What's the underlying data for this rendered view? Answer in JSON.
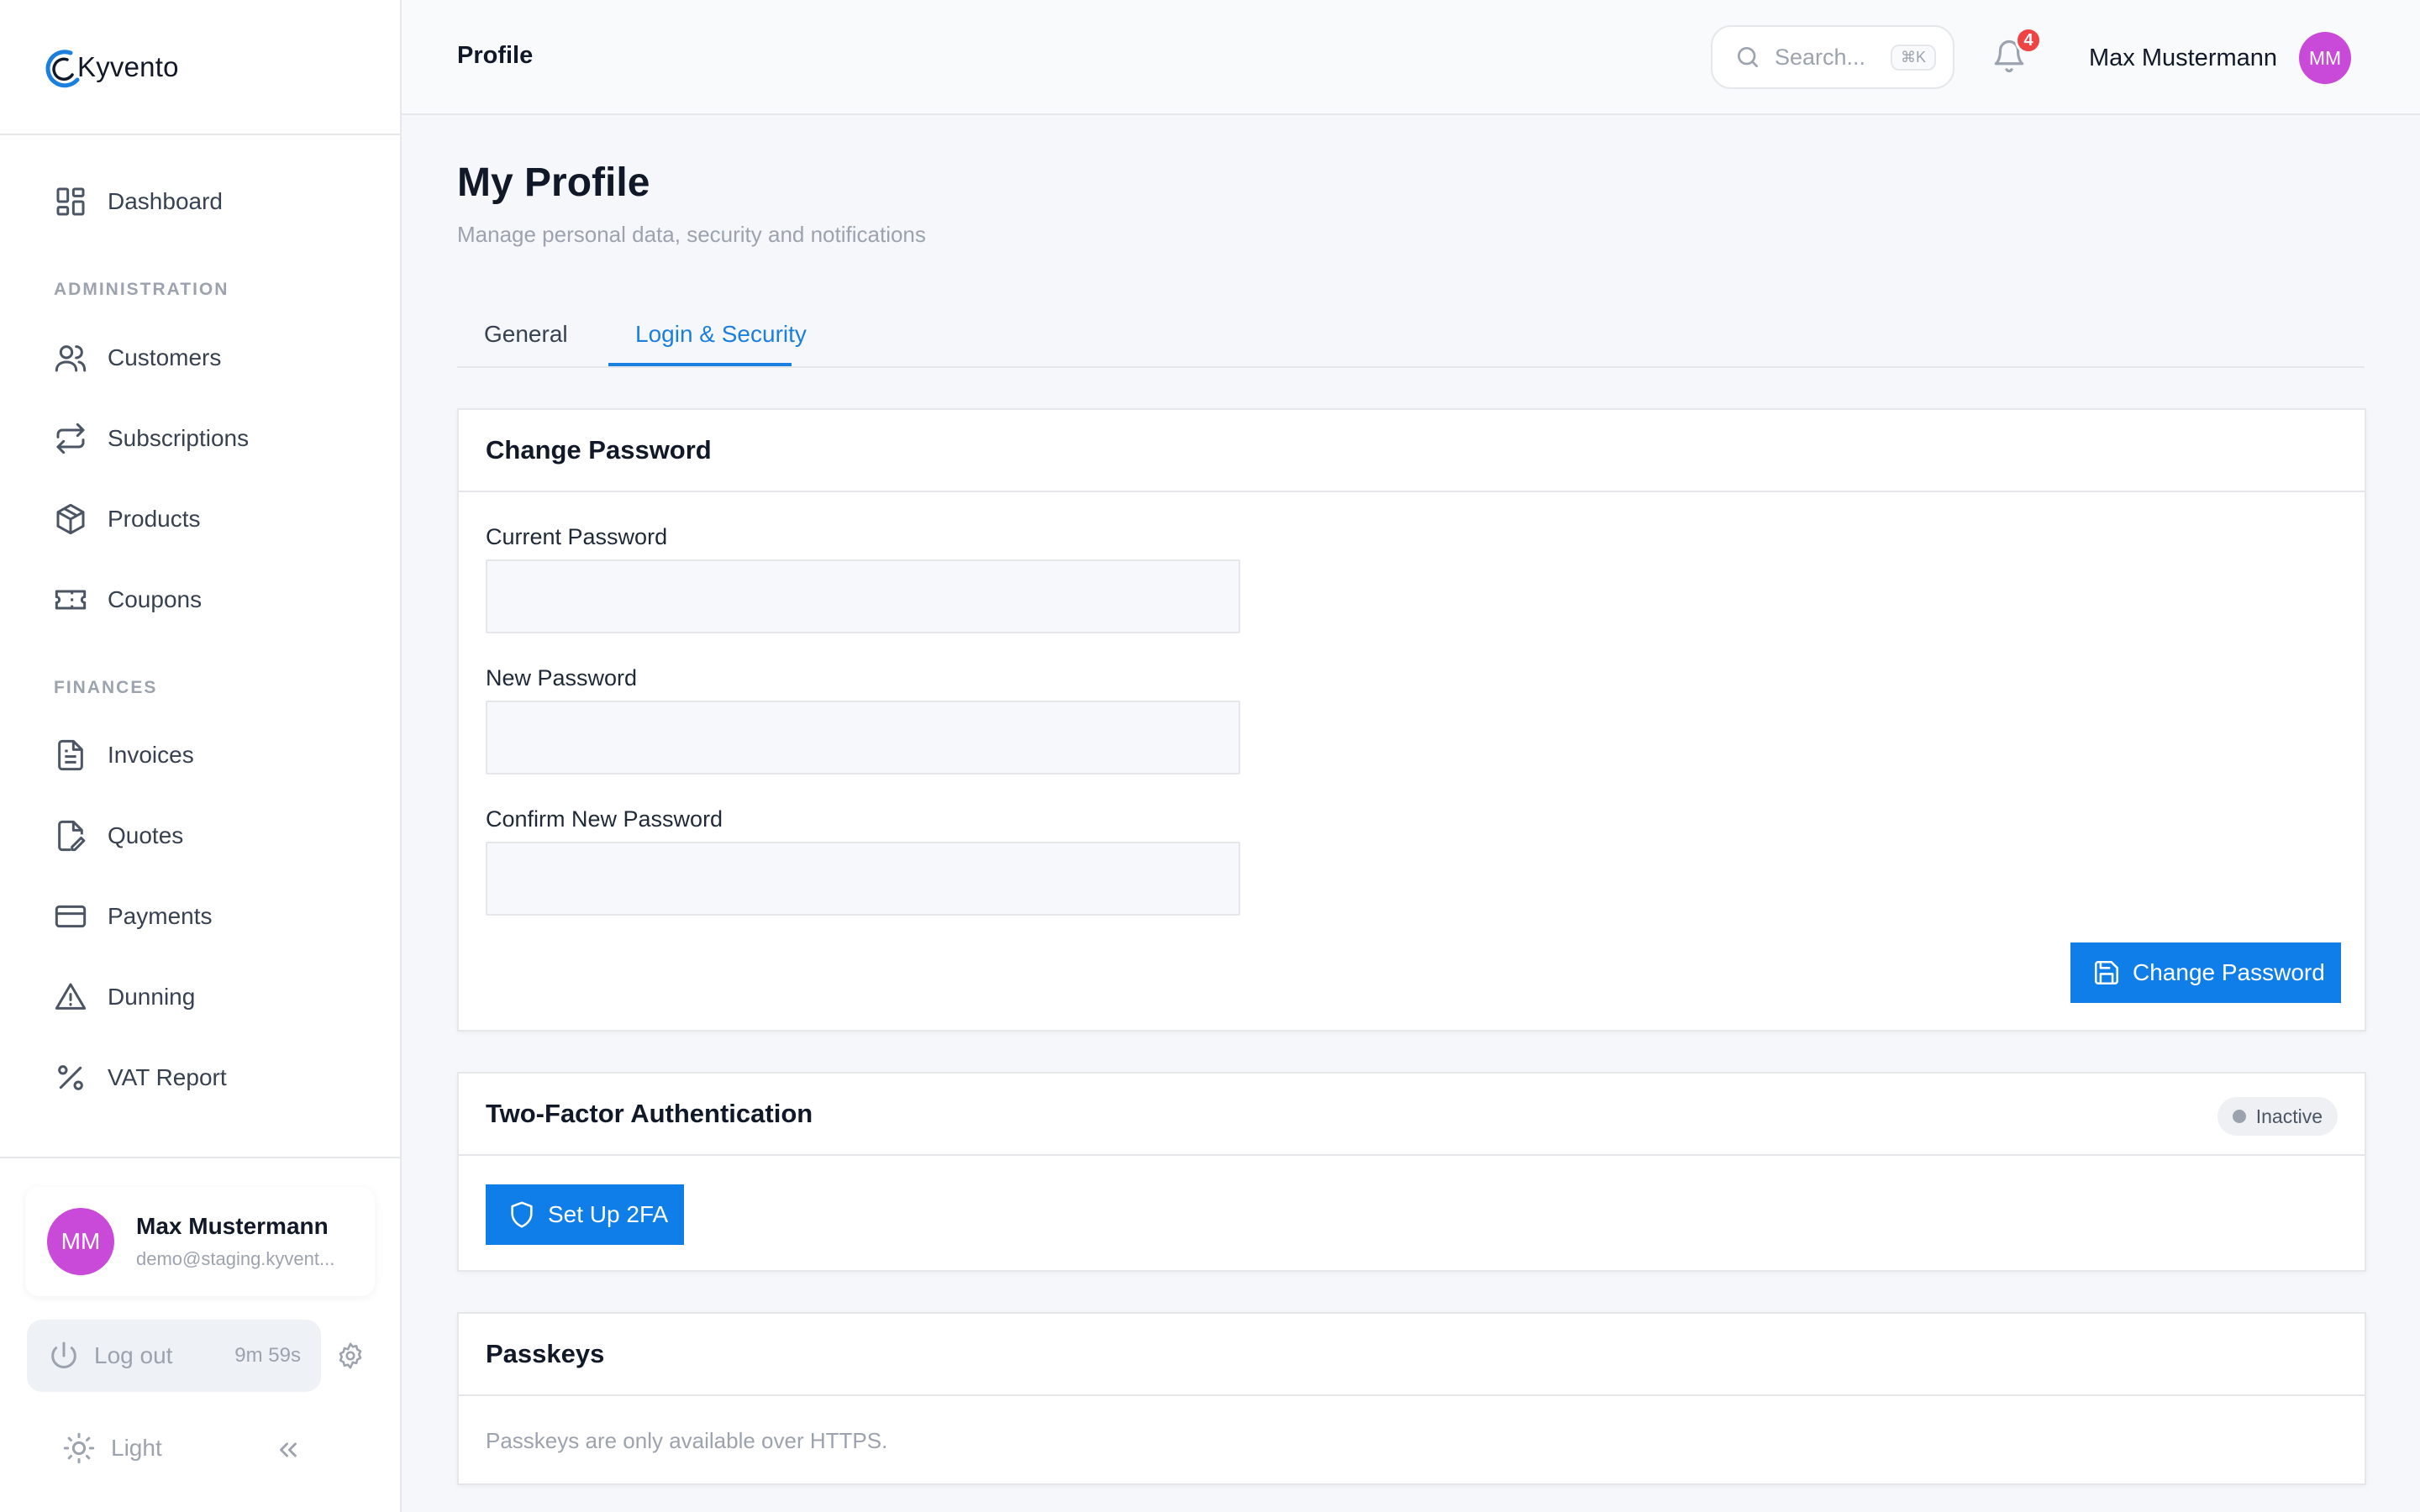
{
  "brand": {
    "name": "Kyvento",
    "accent": "#1b7fe0"
  },
  "sidebar": {
    "dashboard": {
      "label": "Dashboard",
      "icon": "grid-icon"
    },
    "sections": {
      "administration": "ADMINISTRATION",
      "finances": "FINANCES"
    },
    "admin_items": [
      {
        "label": "Customers",
        "icon": "users-icon"
      },
      {
        "label": "Subscriptions",
        "icon": "repeat-icon"
      },
      {
        "label": "Products",
        "icon": "package-icon"
      },
      {
        "label": "Coupons",
        "icon": "ticket-icon"
      }
    ],
    "finance_items": [
      {
        "label": "Invoices",
        "icon": "file-text-icon"
      },
      {
        "label": "Quotes",
        "icon": "file-edit-icon"
      },
      {
        "label": "Payments",
        "icon": "credit-card-icon"
      },
      {
        "label": "Dunning",
        "icon": "alert-triangle-icon"
      },
      {
        "label": "VAT Report",
        "icon": "percent-icon"
      }
    ],
    "user": {
      "initials": "MM",
      "name": "Max Mustermann",
      "email": "demo@staging.kyvent..."
    },
    "logout": {
      "label": "Log out",
      "timer": "9m 59s"
    },
    "theme": {
      "label": "Light"
    }
  },
  "topbar": {
    "title": "Profile",
    "search": {
      "placeholder": "Search...",
      "shortcut": "⌘K"
    },
    "notifications": {
      "count": "4"
    },
    "user": {
      "name": "Max Mustermann",
      "initials": "MM"
    }
  },
  "main": {
    "title": "My Profile",
    "subtitle": "Manage personal data, security and notifications",
    "tabs": [
      {
        "label": "General",
        "active": false
      },
      {
        "label": "Login & Security",
        "active": true
      }
    ],
    "change_password": {
      "heading": "Change Password",
      "fields": [
        {
          "label": "Current Password",
          "value": ""
        },
        {
          "label": "New Password",
          "value": ""
        },
        {
          "label": "Confirm New Password",
          "value": ""
        }
      ],
      "submit_label": "Change Password"
    },
    "two_factor": {
      "heading": "Two-Factor Authentication",
      "status": "Inactive",
      "button_label": "Set Up 2FA"
    },
    "passkeys": {
      "heading": "Passkeys",
      "note": "Passkeys are only available over HTTPS."
    }
  }
}
